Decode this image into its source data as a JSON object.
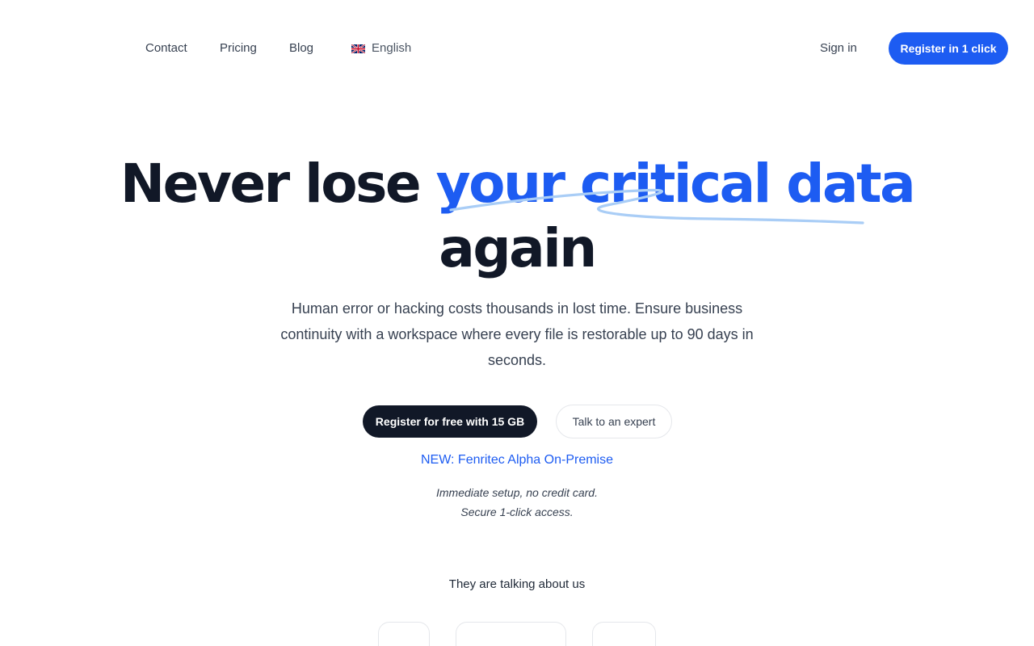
{
  "nav": {
    "contact": "Contact",
    "pricing": "Pricing",
    "blog": "Blog",
    "language": "English",
    "sign_in": "Sign in",
    "register": "Register in 1 click"
  },
  "hero": {
    "title_part1": "Never lose ",
    "title_accent": "your critical data",
    "title_part2": "again",
    "subtitle": "Human error or hacking costs thousands in lost time. Ensure business continuity with a workspace where every file is restorable up to 90 days in seconds.",
    "primary_cta": "Register for free with 15 GB",
    "secondary_cta": "Talk to an expert",
    "new_link": "NEW: Fenritec Alpha On-Premise",
    "note_line1": "Immediate setup, no credit card.",
    "note_line2": "Secure 1-click access."
  },
  "press": {
    "title": "They are talking about us"
  },
  "icons": {
    "language": "uk-flag-icon",
    "title_decoration": "scribble-underline"
  },
  "colors": {
    "brand": "#1d5cf2",
    "dark": "#111827",
    "scribble": "#a9cdf6"
  }
}
